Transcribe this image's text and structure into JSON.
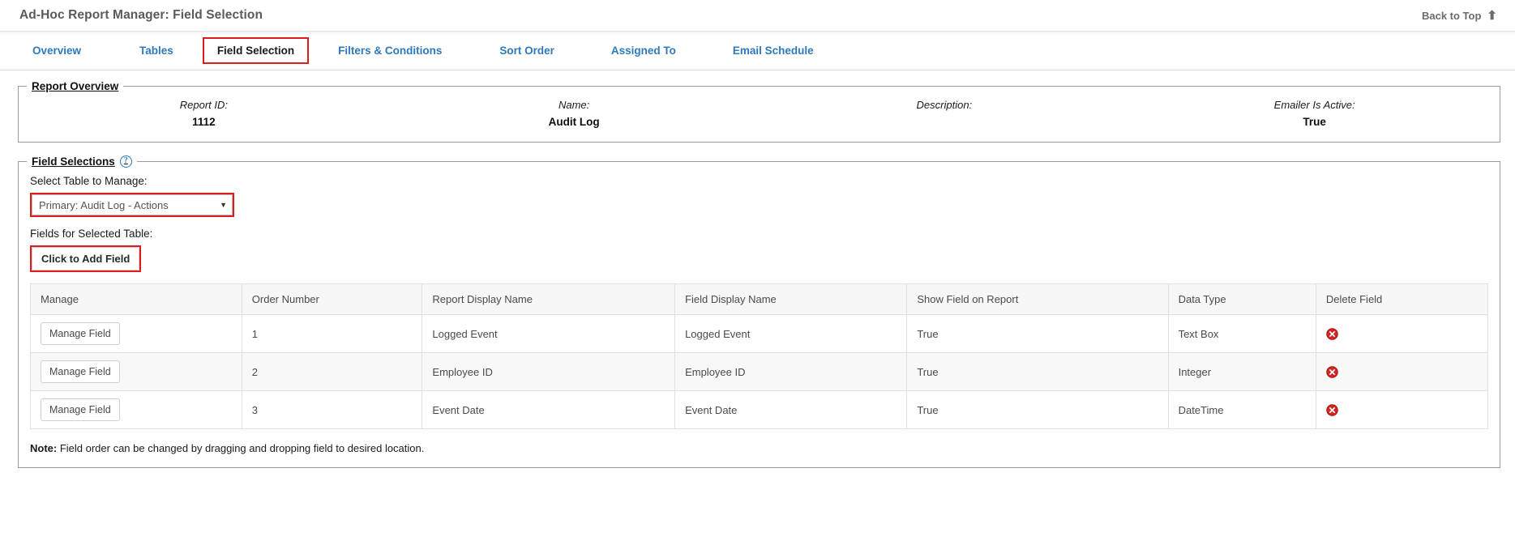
{
  "header": {
    "title": "Ad-Hoc Report Manager: Field Selection",
    "back_to_top": "Back to Top",
    "back_to_top_icon": "arrow-up-icon"
  },
  "tabs": [
    {
      "label": "Overview",
      "active": false
    },
    {
      "label": "Tables",
      "active": false
    },
    {
      "label": "Field Selection",
      "active": true
    },
    {
      "label": "Filters & Conditions",
      "active": false
    },
    {
      "label": "Sort Order",
      "active": false
    },
    {
      "label": "Assigned To",
      "active": false
    },
    {
      "label": "Email Schedule",
      "active": false
    }
  ],
  "report_overview": {
    "legend": "Report Overview",
    "fields": [
      {
        "label": "Report ID:",
        "value": "1112"
      },
      {
        "label": "Name:",
        "value": "Audit Log"
      },
      {
        "label": "Description:",
        "value": ""
      },
      {
        "label": "Emailer Is Active:",
        "value": "True"
      }
    ]
  },
  "field_selections": {
    "legend": "Field Selections",
    "help_icon": "question-mark-icon",
    "help_glyph": "?",
    "select_table_label": "Select Table to Manage:",
    "selected_table": "Primary: Audit Log - Actions",
    "caret_glyph": "▼",
    "fields_label": "Fields for Selected Table:",
    "add_field_label": "Click to Add Field",
    "table": {
      "columns": [
        "Manage",
        "Order Number",
        "Report Display Name",
        "Field Display Name",
        "Show Field on Report",
        "Data Type",
        "Delete Field"
      ],
      "rows": [
        {
          "manage": "Manage Field",
          "order": "1",
          "report_display_name": "Logged Event",
          "field_display_name": "Logged Event",
          "show_on_report": "True",
          "data_type": "Text Box",
          "delete_icon": "delete-circle-icon"
        },
        {
          "manage": "Manage Field",
          "order": "2",
          "report_display_name": "Employee ID",
          "field_display_name": "Employee ID",
          "show_on_report": "True",
          "data_type": "Integer",
          "delete_icon": "delete-circle-icon"
        },
        {
          "manage": "Manage Field",
          "order": "3",
          "report_display_name": "Event Date",
          "field_display_name": "Event Date",
          "show_on_report": "True",
          "data_type": "DateTime",
          "delete_icon": "delete-circle-icon"
        }
      ]
    },
    "note_prefix": "Note:",
    "note_text": " Field order can be changed by dragging and dropping field to desired location."
  },
  "colors": {
    "highlight_border": "#e01b1b",
    "tab_link": "#2e79bd",
    "delete_red": "#d62420",
    "help_blue": "#2e79bd"
  }
}
